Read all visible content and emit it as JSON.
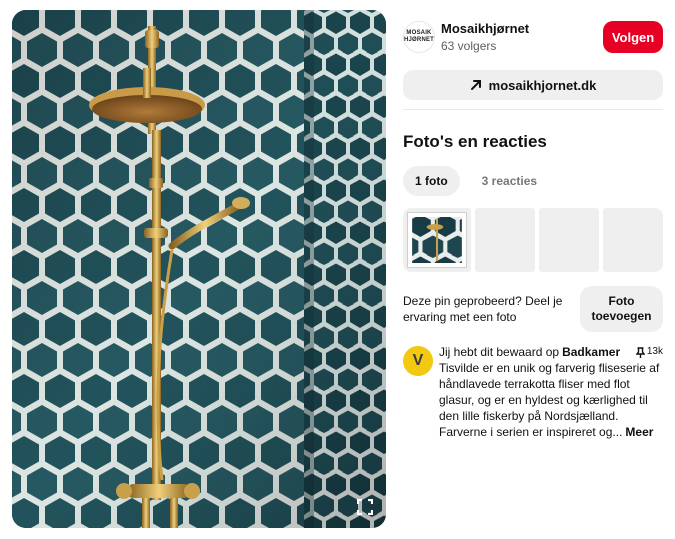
{
  "creator": {
    "logo_text": [
      "MOSAIK",
      "HJØRNET"
    ],
    "name": "Mosaikhjørnet",
    "followers": "63 volgers",
    "follow_label": "Volgen"
  },
  "website": {
    "label": "mosaikhjornet.dk",
    "icon": "arrow-up-right-icon"
  },
  "photos_section": {
    "title": "Foto's en reacties",
    "tabs": [
      {
        "label": "1 foto",
        "active": true
      },
      {
        "label": "3 reacties",
        "active": false
      }
    ]
  },
  "tried": {
    "text": "Deze pin geprobeerd? Deel je ervaring met een foto",
    "button_label": "Foto toevoegen"
  },
  "saved": {
    "avatar_letter": "V",
    "prefix": "Jij hebt dit bewaard op",
    "board": "Badkamer",
    "save_count": "13k",
    "description": "Tisvilde er en unik og farverig fliseserie af håndlavede terrakotta fliser med flot glasur, og er en hyldest og kærlighed til den lille fiskerby på Nordsjælland. Farverne i serien er inspireret og...",
    "more_label": "Meer"
  },
  "colors": {
    "brand_red": "#e60023",
    "tile": "#1f4b55",
    "grout": "#f2f2ee",
    "brass": "#c9a04a",
    "avatar": "#f2c811"
  },
  "icons": [
    "fullscreen-icon",
    "arrow-up-right-icon",
    "pin-icon"
  ]
}
